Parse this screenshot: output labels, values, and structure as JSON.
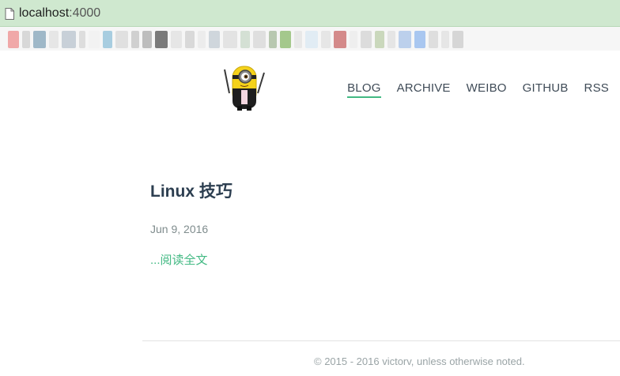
{
  "browser": {
    "url_host": "localhost",
    "url_port": ":4000",
    "bookmark_colors": [
      "#f0a8a8",
      "#d8d8d8",
      "#9fb8c8",
      "#e6e6e6",
      "#c8d0d8",
      "#dddddd",
      "#f2f2f2",
      "#a8cde0",
      "#e0e0e0",
      "#d0d0d0",
      "#bdbdbd",
      "#7a7a7a",
      "#e6e6e6",
      "#d9d9d9",
      "#ececec",
      "#cfd6dc",
      "#e3e3e3",
      "#d4e0d4",
      "#dfdfdf",
      "#b8c8b0",
      "#a4c88c",
      "#e8e8e8",
      "#e1ecf4",
      "#e6e6e6",
      "#d48a8a",
      "#eeeeee",
      "#dcdcdc",
      "#cad8bc",
      "#e5e5e5",
      "#bcd0ec",
      "#a9c7f0",
      "#dedede",
      "#e6e6e6",
      "#d6d6d6"
    ]
  },
  "site": {
    "logo_icon": "minion-logo-icon",
    "nav": [
      {
        "label": "BLOG",
        "active": true
      },
      {
        "label": "ARCHIVE",
        "active": false
      },
      {
        "label": "WEIBO",
        "active": false
      },
      {
        "label": "GITHUB",
        "active": false
      },
      {
        "label": "RSS",
        "active": false
      }
    ],
    "accent_color": "#42b983"
  },
  "post": {
    "title": "Linux 技巧",
    "date": "Jun 9, 2016",
    "read_more": "...阅读全文"
  },
  "footer": {
    "text": "© 2015 - 2016 victorv, unless otherwise noted."
  }
}
